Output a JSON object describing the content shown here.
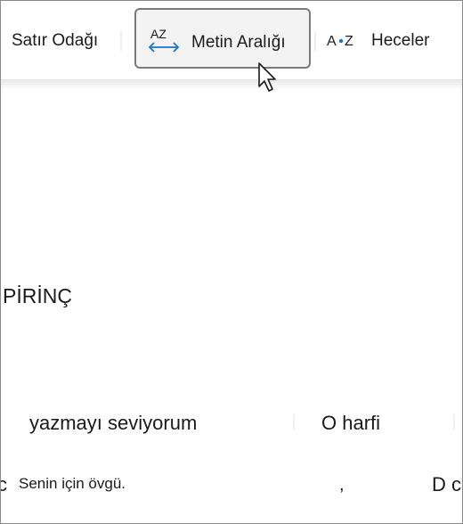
{
  "toolbar": {
    "line_focus_label": "Satır Odağı",
    "text_spacing_label": "Metin Aralığı",
    "text_spacing_icon_text": "AZ",
    "syllables_label": "Heceler",
    "syllables_icon_text": "A•Z",
    "text_spacing_icon": "text-spacing-icon",
    "syllables_icon": "syllables-icon"
  },
  "content": {
    "word_rice": "PİRİNÇ",
    "phrase_writing": "yazmayı seviyorum",
    "letter_o": "O harfi",
    "fragment_left": "c",
    "praise": "Senin için övgü.",
    "fragment_comma": ",",
    "fragment_right": "D c"
  },
  "colors": {
    "accent_blue": "#1a73c9",
    "highlight_bg": "#f3f3f3",
    "highlight_border": "#7a7a7a"
  }
}
